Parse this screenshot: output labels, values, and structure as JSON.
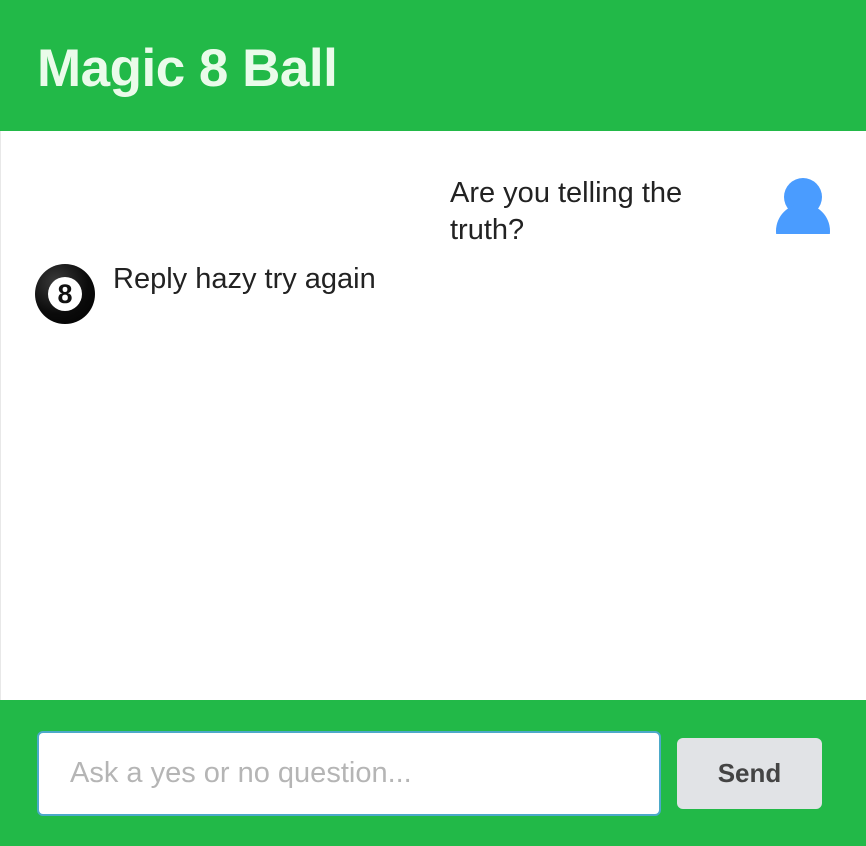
{
  "header": {
    "title": "Magic 8 Ball"
  },
  "chat": {
    "messages": [
      {
        "sender": "user",
        "avatar_icon": "user-avatar-icon",
        "text": "Are you telling the truth?"
      },
      {
        "sender": "bot",
        "avatar_icon": "eight-ball-icon",
        "avatar_glyph": "8",
        "text": "Reply hazy try again"
      }
    ]
  },
  "composer": {
    "input_value": "",
    "input_placeholder": "Ask a yes or no question...",
    "send_label": "Send"
  },
  "colors": {
    "brand_green": "#22b948",
    "user_avatar_blue": "#4a9cff",
    "input_border": "#4ca9c9",
    "send_button_bg": "#e1e3e6"
  }
}
